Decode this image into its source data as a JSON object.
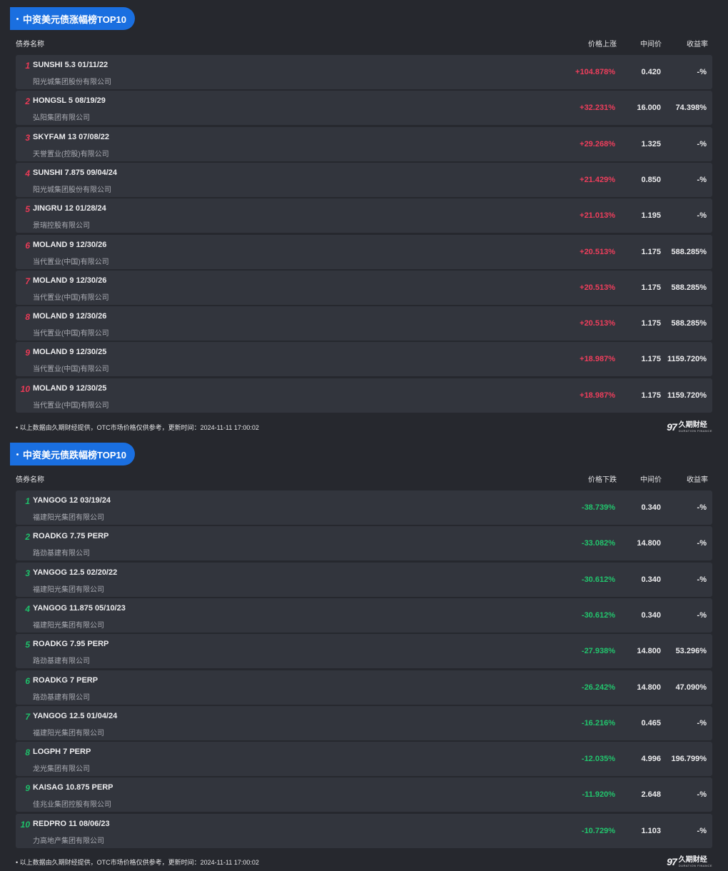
{
  "gainers": {
    "title": "中资美元债涨幅榜TOP10",
    "headers": {
      "name": "债券名称",
      "change": "价格上涨",
      "mid": "中间价",
      "yield": "收益率"
    },
    "rows": [
      {
        "rank": "1",
        "bond": "SUNSHI 5.3 01/11/22",
        "issuer": "阳光城集团股份有限公司",
        "change": "+104.878%",
        "mid": "0.420",
        "yield": "-%"
      },
      {
        "rank": "2",
        "bond": "HONGSL 5 08/19/29",
        "issuer": "弘阳集团有限公司",
        "change": "+32.231%",
        "mid": "16.000",
        "yield": "74.398%"
      },
      {
        "rank": "3",
        "bond": "SKYFAM 13 07/08/22",
        "issuer": "天誉置业(控股)有限公司",
        "change": "+29.268%",
        "mid": "1.325",
        "yield": "-%"
      },
      {
        "rank": "4",
        "bond": "SUNSHI 7.875 09/04/24",
        "issuer": "阳光城集团股份有限公司",
        "change": "+21.429%",
        "mid": "0.850",
        "yield": "-%"
      },
      {
        "rank": "5",
        "bond": "JINGRU 12 01/28/24",
        "issuer": "景瑞控股有限公司",
        "change": "+21.013%",
        "mid": "1.195",
        "yield": "-%"
      },
      {
        "rank": "6",
        "bond": "MOLAND 9 12/30/26",
        "issuer": "当代置业(中国)有限公司",
        "change": "+20.513%",
        "mid": "1.175",
        "yield": "588.285%"
      },
      {
        "rank": "7",
        "bond": "MOLAND 9 12/30/26",
        "issuer": "当代置业(中国)有限公司",
        "change": "+20.513%",
        "mid": "1.175",
        "yield": "588.285%"
      },
      {
        "rank": "8",
        "bond": "MOLAND 9 12/30/26",
        "issuer": "当代置业(中国)有限公司",
        "change": "+20.513%",
        "mid": "1.175",
        "yield": "588.285%"
      },
      {
        "rank": "9",
        "bond": "MOLAND 9 12/30/25",
        "issuer": "当代置业(中国)有限公司",
        "change": "+18.987%",
        "mid": "1.175",
        "yield": "1159.720%"
      },
      {
        "rank": "10",
        "bond": "MOLAND 9 12/30/25",
        "issuer": "当代置业(中国)有限公司",
        "change": "+18.987%",
        "mid": "1.175",
        "yield": "1159.720%"
      }
    ],
    "footer": "• 以上数据由久期财经提供，OTC市场价格仅供参考，更新时间：2024-11-11 17:00:02"
  },
  "losers": {
    "title": "中资美元债跌幅榜TOP10",
    "headers": {
      "name": "债券名称",
      "change": "价格下跌",
      "mid": "中间价",
      "yield": "收益率"
    },
    "rows": [
      {
        "rank": "1",
        "bond": "YANGOG 12 03/19/24",
        "issuer": "福建阳光集团有限公司",
        "change": "-38.739%",
        "mid": "0.340",
        "yield": "-%"
      },
      {
        "rank": "2",
        "bond": "ROADKG 7.75 PERP",
        "issuer": "路劲基建有限公司",
        "change": "-33.082%",
        "mid": "14.800",
        "yield": "-%"
      },
      {
        "rank": "3",
        "bond": "YANGOG 12.5 02/20/22",
        "issuer": "福建阳光集团有限公司",
        "change": "-30.612%",
        "mid": "0.340",
        "yield": "-%"
      },
      {
        "rank": "4",
        "bond": "YANGOG 11.875 05/10/23",
        "issuer": "福建阳光集团有限公司",
        "change": "-30.612%",
        "mid": "0.340",
        "yield": "-%"
      },
      {
        "rank": "5",
        "bond": "ROADKG 7.95 PERP",
        "issuer": "路劲基建有限公司",
        "change": "-27.938%",
        "mid": "14.800",
        "yield": "53.296%"
      },
      {
        "rank": "6",
        "bond": "ROADKG 7 PERP",
        "issuer": "路劲基建有限公司",
        "change": "-26.242%",
        "mid": "14.800",
        "yield": "47.090%"
      },
      {
        "rank": "7",
        "bond": "YANGOG 12.5 01/04/24",
        "issuer": "福建阳光集团有限公司",
        "change": "-16.216%",
        "mid": "0.465",
        "yield": "-%"
      },
      {
        "rank": "8",
        "bond": "LOGPH 7 PERP",
        "issuer": "龙光集团有限公司",
        "change": "-12.035%",
        "mid": "4.996",
        "yield": "196.799%"
      },
      {
        "rank": "9",
        "bond": "KAISAG 10.875 PERP",
        "issuer": "佳兆业集团控股有限公司",
        "change": "-11.920%",
        "mid": "2.648",
        "yield": "-%"
      },
      {
        "rank": "10",
        "bond": "REDPRO 11 08/06/23",
        "issuer": "力高地产集团有限公司",
        "change": "-10.729%",
        "mid": "1.103",
        "yield": "-%"
      }
    ],
    "footer": "• 以上数据由久期财经提供，OTC市场价格仅供参考，更新时间：2024-11-11 17:00:02"
  },
  "logo": {
    "mark": "97",
    "name": "久期财经",
    "name_en": "DURATION FINANCE"
  },
  "colors": {
    "accent": "#1a6fe0",
    "up": "#ef3e5c",
    "down": "#22c56d",
    "row_bg": "#32353d",
    "page_bg": "#26282e"
  }
}
